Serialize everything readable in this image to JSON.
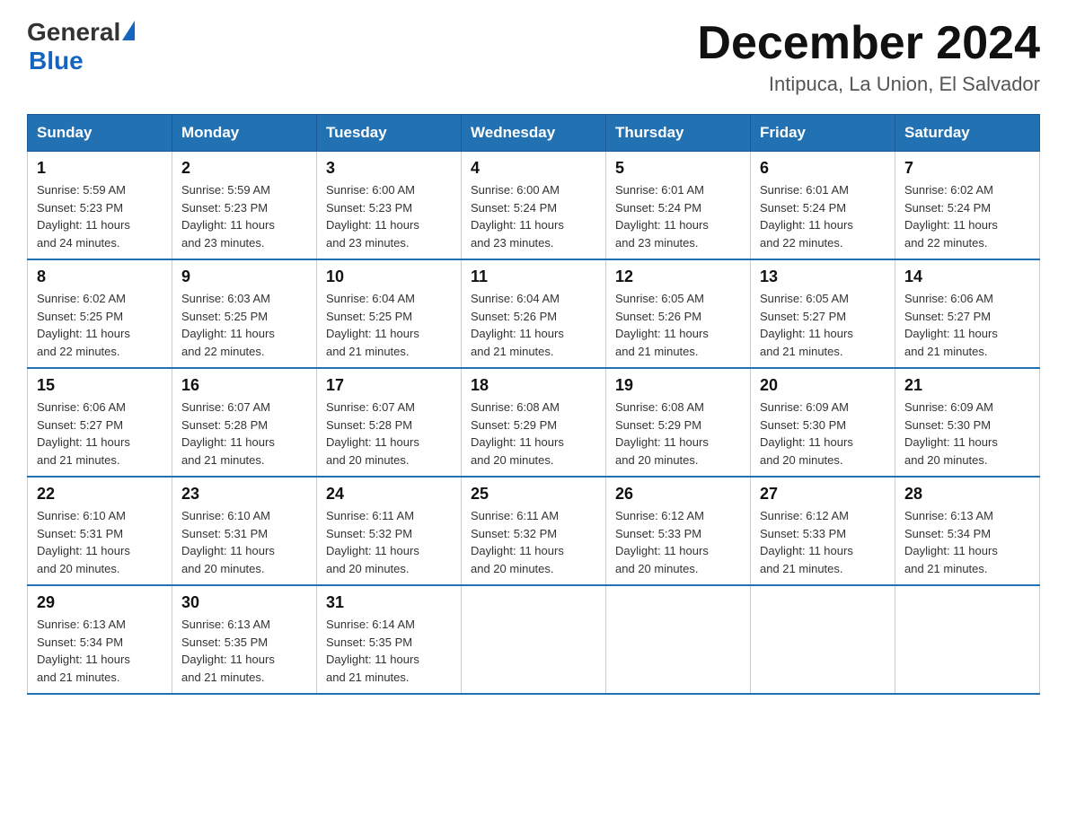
{
  "logo": {
    "general": "General",
    "blue": "Blue"
  },
  "title": "December 2024",
  "location": "Intipuca, La Union, El Salvador",
  "days_of_week": [
    "Sunday",
    "Monday",
    "Tuesday",
    "Wednesday",
    "Thursday",
    "Friday",
    "Saturday"
  ],
  "weeks": [
    [
      {
        "day": "1",
        "sunrise": "5:59 AM",
        "sunset": "5:23 PM",
        "daylight": "11 hours and 24 minutes."
      },
      {
        "day": "2",
        "sunrise": "5:59 AM",
        "sunset": "5:23 PM",
        "daylight": "11 hours and 23 minutes."
      },
      {
        "day": "3",
        "sunrise": "6:00 AM",
        "sunset": "5:23 PM",
        "daylight": "11 hours and 23 minutes."
      },
      {
        "day": "4",
        "sunrise": "6:00 AM",
        "sunset": "5:24 PM",
        "daylight": "11 hours and 23 minutes."
      },
      {
        "day": "5",
        "sunrise": "6:01 AM",
        "sunset": "5:24 PM",
        "daylight": "11 hours and 23 minutes."
      },
      {
        "day": "6",
        "sunrise": "6:01 AM",
        "sunset": "5:24 PM",
        "daylight": "11 hours and 22 minutes."
      },
      {
        "day": "7",
        "sunrise": "6:02 AM",
        "sunset": "5:24 PM",
        "daylight": "11 hours and 22 minutes."
      }
    ],
    [
      {
        "day": "8",
        "sunrise": "6:02 AM",
        "sunset": "5:25 PM",
        "daylight": "11 hours and 22 minutes."
      },
      {
        "day": "9",
        "sunrise": "6:03 AM",
        "sunset": "5:25 PM",
        "daylight": "11 hours and 22 minutes."
      },
      {
        "day": "10",
        "sunrise": "6:04 AM",
        "sunset": "5:25 PM",
        "daylight": "11 hours and 21 minutes."
      },
      {
        "day": "11",
        "sunrise": "6:04 AM",
        "sunset": "5:26 PM",
        "daylight": "11 hours and 21 minutes."
      },
      {
        "day": "12",
        "sunrise": "6:05 AM",
        "sunset": "5:26 PM",
        "daylight": "11 hours and 21 minutes."
      },
      {
        "day": "13",
        "sunrise": "6:05 AM",
        "sunset": "5:27 PM",
        "daylight": "11 hours and 21 minutes."
      },
      {
        "day": "14",
        "sunrise": "6:06 AM",
        "sunset": "5:27 PM",
        "daylight": "11 hours and 21 minutes."
      }
    ],
    [
      {
        "day": "15",
        "sunrise": "6:06 AM",
        "sunset": "5:27 PM",
        "daylight": "11 hours and 21 minutes."
      },
      {
        "day": "16",
        "sunrise": "6:07 AM",
        "sunset": "5:28 PM",
        "daylight": "11 hours and 21 minutes."
      },
      {
        "day": "17",
        "sunrise": "6:07 AM",
        "sunset": "5:28 PM",
        "daylight": "11 hours and 20 minutes."
      },
      {
        "day": "18",
        "sunrise": "6:08 AM",
        "sunset": "5:29 PM",
        "daylight": "11 hours and 20 minutes."
      },
      {
        "day": "19",
        "sunrise": "6:08 AM",
        "sunset": "5:29 PM",
        "daylight": "11 hours and 20 minutes."
      },
      {
        "day": "20",
        "sunrise": "6:09 AM",
        "sunset": "5:30 PM",
        "daylight": "11 hours and 20 minutes."
      },
      {
        "day": "21",
        "sunrise": "6:09 AM",
        "sunset": "5:30 PM",
        "daylight": "11 hours and 20 minutes."
      }
    ],
    [
      {
        "day": "22",
        "sunrise": "6:10 AM",
        "sunset": "5:31 PM",
        "daylight": "11 hours and 20 minutes."
      },
      {
        "day": "23",
        "sunrise": "6:10 AM",
        "sunset": "5:31 PM",
        "daylight": "11 hours and 20 minutes."
      },
      {
        "day": "24",
        "sunrise": "6:11 AM",
        "sunset": "5:32 PM",
        "daylight": "11 hours and 20 minutes."
      },
      {
        "day": "25",
        "sunrise": "6:11 AM",
        "sunset": "5:32 PM",
        "daylight": "11 hours and 20 minutes."
      },
      {
        "day": "26",
        "sunrise": "6:12 AM",
        "sunset": "5:33 PM",
        "daylight": "11 hours and 20 minutes."
      },
      {
        "day": "27",
        "sunrise": "6:12 AM",
        "sunset": "5:33 PM",
        "daylight": "11 hours and 21 minutes."
      },
      {
        "day": "28",
        "sunrise": "6:13 AM",
        "sunset": "5:34 PM",
        "daylight": "11 hours and 21 minutes."
      }
    ],
    [
      {
        "day": "29",
        "sunrise": "6:13 AM",
        "sunset": "5:34 PM",
        "daylight": "11 hours and 21 minutes."
      },
      {
        "day": "30",
        "sunrise": "6:13 AM",
        "sunset": "5:35 PM",
        "daylight": "11 hours and 21 minutes."
      },
      {
        "day": "31",
        "sunrise": "6:14 AM",
        "sunset": "5:35 PM",
        "daylight": "11 hours and 21 minutes."
      },
      null,
      null,
      null,
      null
    ]
  ],
  "labels": {
    "sunrise": "Sunrise:",
    "sunset": "Sunset:",
    "daylight": "Daylight:"
  }
}
